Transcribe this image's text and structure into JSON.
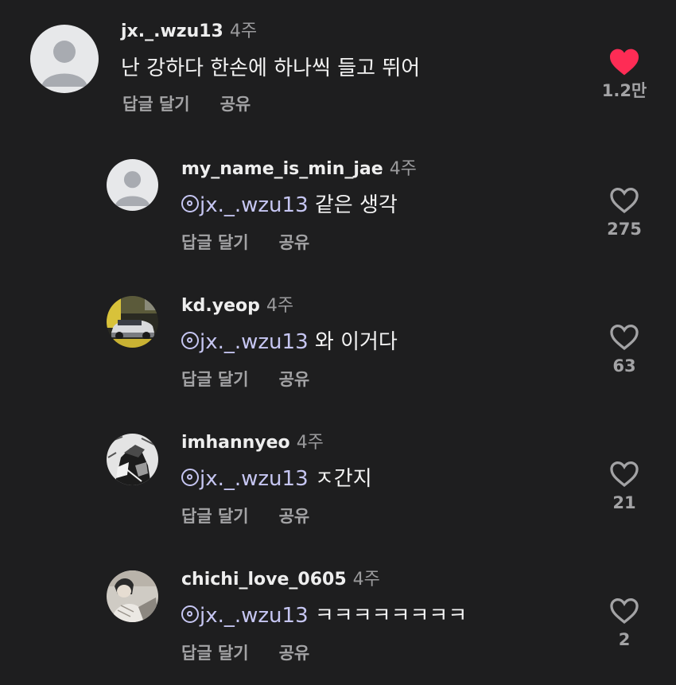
{
  "colors": {
    "background": "#1e1e1f",
    "liked_heart": "#fe2c55",
    "mention": "#c6c6f2",
    "secondary_text": "#a3a3a5"
  },
  "comments": [
    {
      "username": "jx._.wzu13",
      "time": "4주",
      "text": "난 강하다 한손에 하나씩 들고 뛰어",
      "reply_label": "답글 달기",
      "share_label": "공유",
      "likes": "1.2만",
      "liked": true,
      "avatar": "default-avatar-icon"
    }
  ],
  "replies": [
    {
      "username": "my_name_is_min_jae",
      "time": "4주",
      "mention": "jx._.wzu13",
      "text": "같은 생각",
      "reply_label": "답글 달기",
      "share_label": "공유",
      "likes": "275",
      "liked": false,
      "avatar": "default-avatar-icon"
    },
    {
      "username": "kd.yeop",
      "time": "4주",
      "mention": "jx._.wzu13",
      "text": "와 이거다",
      "reply_label": "답글 달기",
      "share_label": "공유",
      "likes": "63",
      "liked": false,
      "avatar": "car-photo-avatar"
    },
    {
      "username": "imhannyeo",
      "time": "4주",
      "mention": "jx._.wzu13",
      "text": "ㅈ간지",
      "reply_label": "답글 달기",
      "share_label": "공유",
      "likes": "21",
      "liked": false,
      "avatar": "manga-art-avatar"
    },
    {
      "username": "chichi_love_0605",
      "time": "4주",
      "mention": "jx._.wzu13",
      "text": "ㅋㅋㅋㅋㅋㅋㅋㅋ",
      "reply_label": "답글 달기",
      "share_label": "공유",
      "likes": "2",
      "liked": false,
      "avatar": "photo-avatar"
    }
  ]
}
